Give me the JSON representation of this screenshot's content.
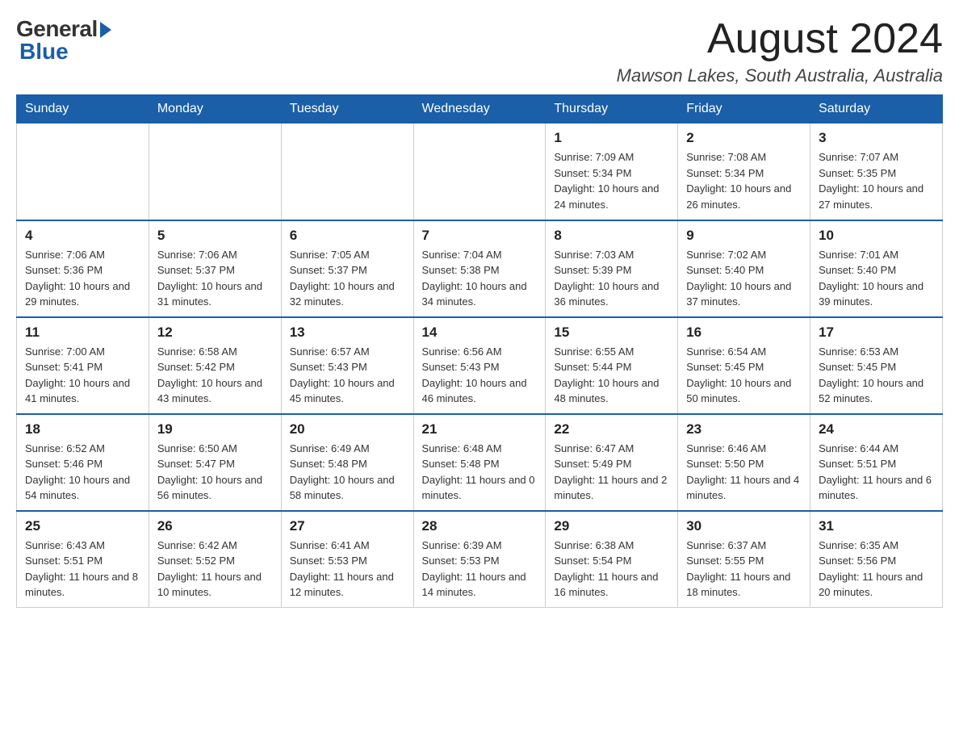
{
  "logo": {
    "general": "General",
    "blue": "Blue"
  },
  "title": {
    "month_year": "August 2024",
    "location": "Mawson Lakes, South Australia, Australia"
  },
  "headers": [
    "Sunday",
    "Monday",
    "Tuesday",
    "Wednesday",
    "Thursday",
    "Friday",
    "Saturday"
  ],
  "weeks": [
    [
      {
        "day": "",
        "info": ""
      },
      {
        "day": "",
        "info": ""
      },
      {
        "day": "",
        "info": ""
      },
      {
        "day": "",
        "info": ""
      },
      {
        "day": "1",
        "info": "Sunrise: 7:09 AM\nSunset: 5:34 PM\nDaylight: 10 hours and 24 minutes."
      },
      {
        "day": "2",
        "info": "Sunrise: 7:08 AM\nSunset: 5:34 PM\nDaylight: 10 hours and 26 minutes."
      },
      {
        "day": "3",
        "info": "Sunrise: 7:07 AM\nSunset: 5:35 PM\nDaylight: 10 hours and 27 minutes."
      }
    ],
    [
      {
        "day": "4",
        "info": "Sunrise: 7:06 AM\nSunset: 5:36 PM\nDaylight: 10 hours and 29 minutes."
      },
      {
        "day": "5",
        "info": "Sunrise: 7:06 AM\nSunset: 5:37 PM\nDaylight: 10 hours and 31 minutes."
      },
      {
        "day": "6",
        "info": "Sunrise: 7:05 AM\nSunset: 5:37 PM\nDaylight: 10 hours and 32 minutes."
      },
      {
        "day": "7",
        "info": "Sunrise: 7:04 AM\nSunset: 5:38 PM\nDaylight: 10 hours and 34 minutes."
      },
      {
        "day": "8",
        "info": "Sunrise: 7:03 AM\nSunset: 5:39 PM\nDaylight: 10 hours and 36 minutes."
      },
      {
        "day": "9",
        "info": "Sunrise: 7:02 AM\nSunset: 5:40 PM\nDaylight: 10 hours and 37 minutes."
      },
      {
        "day": "10",
        "info": "Sunrise: 7:01 AM\nSunset: 5:40 PM\nDaylight: 10 hours and 39 minutes."
      }
    ],
    [
      {
        "day": "11",
        "info": "Sunrise: 7:00 AM\nSunset: 5:41 PM\nDaylight: 10 hours and 41 minutes."
      },
      {
        "day": "12",
        "info": "Sunrise: 6:58 AM\nSunset: 5:42 PM\nDaylight: 10 hours and 43 minutes."
      },
      {
        "day": "13",
        "info": "Sunrise: 6:57 AM\nSunset: 5:43 PM\nDaylight: 10 hours and 45 minutes."
      },
      {
        "day": "14",
        "info": "Sunrise: 6:56 AM\nSunset: 5:43 PM\nDaylight: 10 hours and 46 minutes."
      },
      {
        "day": "15",
        "info": "Sunrise: 6:55 AM\nSunset: 5:44 PM\nDaylight: 10 hours and 48 minutes."
      },
      {
        "day": "16",
        "info": "Sunrise: 6:54 AM\nSunset: 5:45 PM\nDaylight: 10 hours and 50 minutes."
      },
      {
        "day": "17",
        "info": "Sunrise: 6:53 AM\nSunset: 5:45 PM\nDaylight: 10 hours and 52 minutes."
      }
    ],
    [
      {
        "day": "18",
        "info": "Sunrise: 6:52 AM\nSunset: 5:46 PM\nDaylight: 10 hours and 54 minutes."
      },
      {
        "day": "19",
        "info": "Sunrise: 6:50 AM\nSunset: 5:47 PM\nDaylight: 10 hours and 56 minutes."
      },
      {
        "day": "20",
        "info": "Sunrise: 6:49 AM\nSunset: 5:48 PM\nDaylight: 10 hours and 58 minutes."
      },
      {
        "day": "21",
        "info": "Sunrise: 6:48 AM\nSunset: 5:48 PM\nDaylight: 11 hours and 0 minutes."
      },
      {
        "day": "22",
        "info": "Sunrise: 6:47 AM\nSunset: 5:49 PM\nDaylight: 11 hours and 2 minutes."
      },
      {
        "day": "23",
        "info": "Sunrise: 6:46 AM\nSunset: 5:50 PM\nDaylight: 11 hours and 4 minutes."
      },
      {
        "day": "24",
        "info": "Sunrise: 6:44 AM\nSunset: 5:51 PM\nDaylight: 11 hours and 6 minutes."
      }
    ],
    [
      {
        "day": "25",
        "info": "Sunrise: 6:43 AM\nSunset: 5:51 PM\nDaylight: 11 hours and 8 minutes."
      },
      {
        "day": "26",
        "info": "Sunrise: 6:42 AM\nSunset: 5:52 PM\nDaylight: 11 hours and 10 minutes."
      },
      {
        "day": "27",
        "info": "Sunrise: 6:41 AM\nSunset: 5:53 PM\nDaylight: 11 hours and 12 minutes."
      },
      {
        "day": "28",
        "info": "Sunrise: 6:39 AM\nSunset: 5:53 PM\nDaylight: 11 hours and 14 minutes."
      },
      {
        "day": "29",
        "info": "Sunrise: 6:38 AM\nSunset: 5:54 PM\nDaylight: 11 hours and 16 minutes."
      },
      {
        "day": "30",
        "info": "Sunrise: 6:37 AM\nSunset: 5:55 PM\nDaylight: 11 hours and 18 minutes."
      },
      {
        "day": "31",
        "info": "Sunrise: 6:35 AM\nSunset: 5:56 PM\nDaylight: 11 hours and 20 minutes."
      }
    ]
  ]
}
